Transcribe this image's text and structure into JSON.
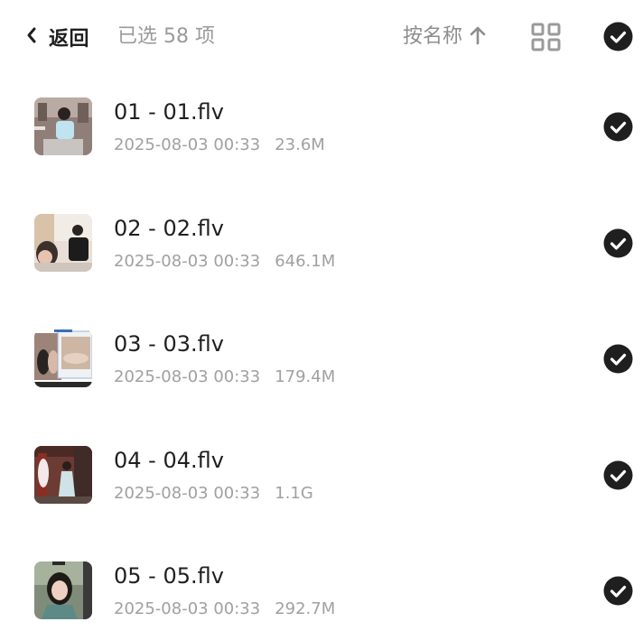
{
  "header": {
    "back_label": "返回",
    "selected_text": "已选 58 项",
    "sort_label": "按名称",
    "sort_icon": "arrow-up-icon",
    "view_icon": "grid-view-icon",
    "select_all_icon": "check-circle-icon"
  },
  "files": [
    {
      "name": "01 - 01.flv",
      "date": "2025-08-03 00:33",
      "size": "23.6M",
      "selected": true
    },
    {
      "name": "02 - 02.flv",
      "date": "2025-08-03 00:33",
      "size": "646.1M",
      "selected": true
    },
    {
      "name": "03 - 03.flv",
      "date": "2025-08-03 00:33",
      "size": "179.4M",
      "selected": true
    },
    {
      "name": "04 - 04.flv",
      "date": "2025-08-03 00:33",
      "size": "1.1G",
      "selected": true
    },
    {
      "name": "05 - 05.flv",
      "date": "2025-08-03 00:33",
      "size": "292.7M",
      "selected": true
    }
  ],
  "colors": {
    "text_primary": "#1f1f1f",
    "text_secondary": "#a0a0a0",
    "check_fill": "#1f1f1f",
    "background": "#ffffff"
  }
}
